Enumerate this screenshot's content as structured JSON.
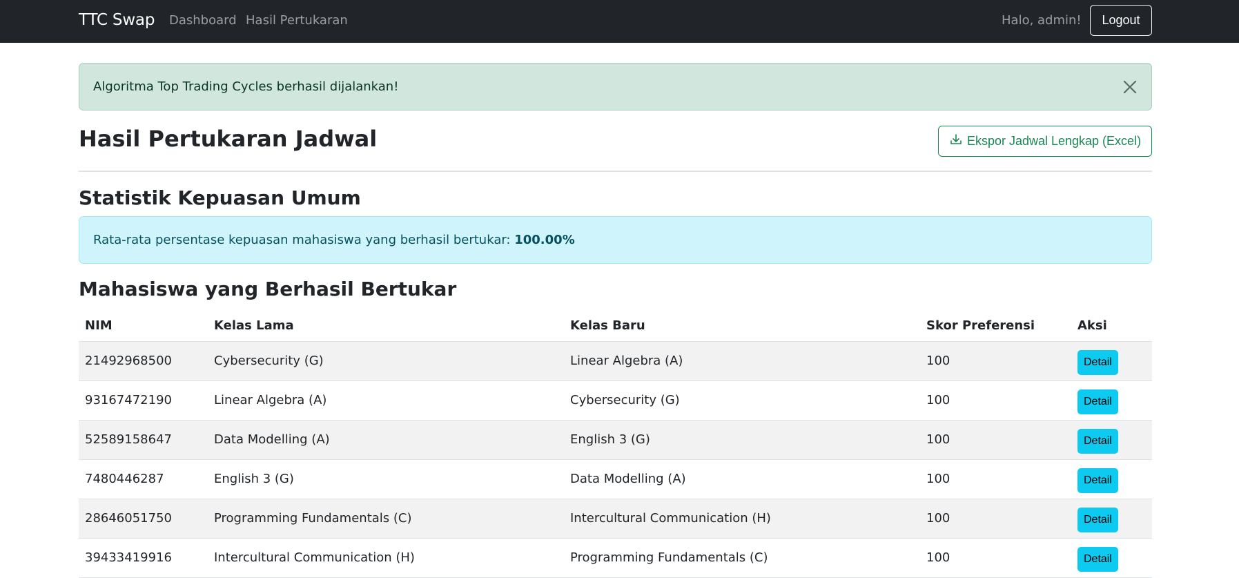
{
  "navbar": {
    "brand": "TTC Swap",
    "links": [
      "Dashboard",
      "Hasil Pertukaran"
    ],
    "greeting": "Halo, admin!",
    "logout_label": "Logout"
  },
  "alert_success": {
    "message": "Algoritma Top Trading Cycles berhasil dijalankan!",
    "close_icon": "close-icon"
  },
  "page": {
    "title": "Hasil Pertukaran Jadwal",
    "export_label": "Ekspor Jadwal Lengkap (Excel)",
    "export_icon": "download-icon"
  },
  "stats": {
    "title": "Statistik Kepuasan Umum",
    "text": "Rata-rata persentase kepuasan mahasiswa yang berhasil bertukar:",
    "value": "100.00%"
  },
  "table": {
    "title": "Mahasiswa yang Berhasil Bertukar",
    "headers": [
      "NIM",
      "Kelas Lama",
      "Kelas Baru",
      "Skor Preferensi",
      "Aksi"
    ],
    "rows": [
      {
        "nim": "21492968500",
        "kelas_lama": "Cybersecurity (G)",
        "kelas_baru": "Linear Algebra (A)",
        "skor": "100",
        "aksi": "Detail"
      },
      {
        "nim": "93167472190",
        "kelas_lama": "Linear Algebra (A)",
        "kelas_baru": "Cybersecurity (G)",
        "skor": "100",
        "aksi": "Detail"
      },
      {
        "nim": "52589158647",
        "kelas_lama": "Data Modelling (A)",
        "kelas_baru": "English 3 (G)",
        "skor": "100",
        "aksi": "Detail"
      },
      {
        "nim": "7480446287",
        "kelas_lama": "English 3 (G)",
        "kelas_baru": "Data Modelling (A)",
        "skor": "100",
        "aksi": "Detail"
      },
      {
        "nim": "28646051750",
        "kelas_lama": "Programming Fundamentals (C)",
        "kelas_baru": "Intercultural Communication (H)",
        "skor": "100",
        "aksi": "Detail"
      },
      {
        "nim": "39433419916",
        "kelas_lama": "Intercultural Communication (H)",
        "kelas_baru": "Programming Fundamentals (C)",
        "skor": "100",
        "aksi": "Detail"
      }
    ]
  },
  "colors": {
    "navbar_bg": "#212529",
    "success_bg": "#d1e7dd",
    "info_bg": "#cff4fc",
    "export_green": "#198754",
    "detail_btn": "#0dcaf0"
  }
}
